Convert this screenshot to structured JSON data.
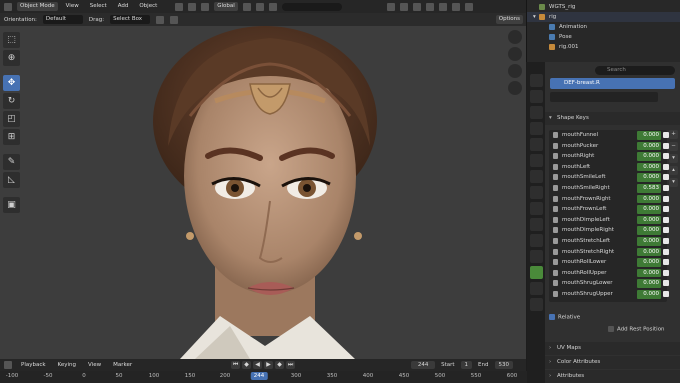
{
  "viewport_header": {
    "mode": "Object Mode",
    "menus": [
      "View",
      "Select",
      "Add",
      "Object"
    ],
    "transform_orientation": "Global"
  },
  "tool_header": {
    "orientation_label": "Orientation:",
    "orientation_value": "Default",
    "drag_label": "Drag:",
    "drag_value": "Select Box",
    "options_label": "Options"
  },
  "timeline": {
    "menus": [
      "Playback",
      "Keying",
      "View",
      "Marker"
    ],
    "current_frame": "244",
    "start_label": "Start",
    "start_value": "1",
    "end_label": "End",
    "end_value": "530",
    "ruler_ticks": [
      "-100",
      "-50",
      "0",
      "50",
      "100",
      "150",
      "200",
      "250",
      "300",
      "350",
      "400",
      "450",
      "500",
      "550",
      "600"
    ],
    "ruler_current": "244"
  },
  "outliner": {
    "rows": [
      {
        "label": "WGTS_rig",
        "indent": 1
      },
      {
        "label": "rig",
        "indent": 1
      },
      {
        "label": "Animation",
        "indent": 2
      },
      {
        "label": "Pose",
        "indent": 2
      },
      {
        "label": "rig.001",
        "indent": 2
      }
    ]
  },
  "properties": {
    "search_placeholder": "Search",
    "mesh_name": "DEF-breast.R",
    "shape_keys_header": "Shape Keys",
    "shape_keys": [
      {
        "name": "mouthFunnel",
        "value": "0.000"
      },
      {
        "name": "mouthPucker",
        "value": "0.000"
      },
      {
        "name": "mouthRight",
        "value": "0.000"
      },
      {
        "name": "mouthLeft",
        "value": "0.000"
      },
      {
        "name": "mouthSmileLeft",
        "value": "0.000"
      },
      {
        "name": "mouthSmileRight",
        "value": "0.583"
      },
      {
        "name": "mouthFrownRight",
        "value": "0.000"
      },
      {
        "name": "mouthFrownLeft",
        "value": "0.000"
      },
      {
        "name": "mouthDimpleLeft",
        "value": "0.000"
      },
      {
        "name": "mouthDimpleRight",
        "value": "0.000"
      },
      {
        "name": "mouthStretchLeft",
        "value": "0.000"
      },
      {
        "name": "mouthStretchRight",
        "value": "0.000"
      },
      {
        "name": "mouthRollLower",
        "value": "0.000"
      },
      {
        "name": "mouthRollUpper",
        "value": "0.000"
      },
      {
        "name": "mouthShrugLower",
        "value": "0.000"
      },
      {
        "name": "mouthShrugUpper",
        "value": "0.000"
      }
    ],
    "relative_label": "Relative",
    "add_rest_label": "Add Rest Position",
    "sections": [
      "UV Maps",
      "Color Attributes",
      "Attributes"
    ]
  },
  "colors": {
    "accent": "#4772b3",
    "value_green": "#3e7a35",
    "panel": "#303030",
    "viewport_bg": "#3d3d3d"
  }
}
